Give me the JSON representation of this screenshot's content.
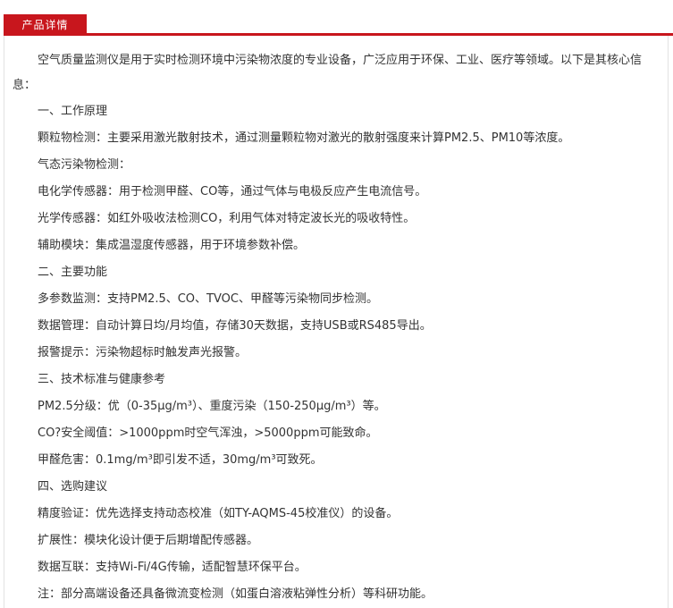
{
  "tab": {
    "label": "产品详情"
  },
  "intro": "空气质量监测仪是用于实时检测环境中污染物浓度的专业设备，广泛应用于环保、工业、医疗等领域。以下是其核心信息：",
  "lines": [
    "一、工作原理",
    "颗粒物检测：主要采用激光散射技术，通过测量颗粒物对激光的散射强度来计算PM2.5、PM10等浓度。",
    "气态污染物检测：",
    "电化学传感器：用于检测甲醛、CO等，通过气体与电极反应产生电流信号。",
    "光学传感器：如红外吸收法检测CO，利用气体对特定波长光的吸收特性。",
    "辅助模块：集成温湿度传感器，用于环境参数补偿。",
    "二、主要功能",
    "多参数监测：支持PM2.5、CO、TVOC、甲醛等污染物同步检测。",
    "数据管理：自动计算日均/月均值，存储30天数据，支持USB或RS485导出。",
    "报警提示：污染物超标时触发声光报警。",
    "三、技术标准与健康参考",
    "PM2.5分级：优（0-35μg/m³）、重度污染（150-250μg/m³）等。",
    "CO?安全阈值：>1000ppm时空气浑浊，>5000ppm可能致命。",
    "甲醛危害：0.1mg/m³即引发不适，30mg/m³可致死。",
    "四、选购建议",
    "精度验证：优先选择支持动态校准（如TY-AQMS-45校准仪）的设备。",
    "扩展性：模块化设计便于后期增配传感器。",
    "数据互联：支持Wi-Fi/4G传输，适配智慧环保平台。",
    "注：部分高端设备还具备微流变检测（如蛋白溶液粘弹性分析）等科研功能。"
  ]
}
